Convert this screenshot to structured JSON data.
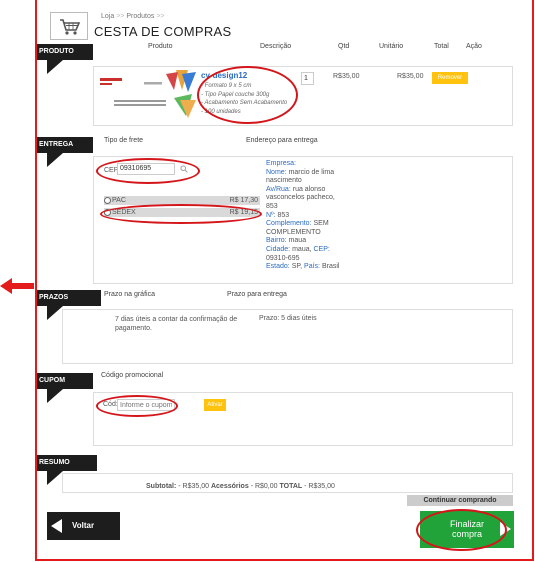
{
  "breadcrumb": {
    "home": "Loja",
    "sep": ">>",
    "products": "Produtos"
  },
  "page_title": "CESTA DE COMPRAS",
  "product_section": {
    "tab": "PRODUTO",
    "headers": [
      "Produto",
      "Descrição",
      "Qtd",
      "Unitário",
      "Total",
      "Ação"
    ],
    "item": {
      "name": "cv-design12",
      "specs": [
        "- Formato 9 x 5 cm",
        "- Tipo Papel couche 300g",
        "- Acabamento Sem Acabamento",
        "- 100 unidades"
      ],
      "quantity": "1",
      "unit_price": "R$35,00",
      "total": "R$35,00",
      "remove_label": "Remover"
    }
  },
  "delivery_section": {
    "tab": "ENTREGA",
    "freight_header": "Tipo de frete",
    "address_header": "Endereço para entrega",
    "cep_label": "CEP:",
    "cep_value": "09310695",
    "options": [
      {
        "name": "PAC",
        "price": "R$ 17,30"
      },
      {
        "name": "SEDEX",
        "price": "R$ 19,15"
      }
    ],
    "address": [
      {
        "label": "Empresa:",
        "value": ""
      },
      {
        "label": "Nome:",
        "value": "marcio de lima nascimento"
      },
      {
        "label": "Av/Rua:",
        "value": "rua alonso vasconcelos pacheco, 853"
      },
      {
        "label": "Nº:",
        "value": "853"
      },
      {
        "label": "Complemento:",
        "value": "SEM COMPLEMENTO"
      },
      {
        "label": "Bairro:",
        "value": "maua"
      },
      {
        "label": "Cidade:",
        "value": "maua"
      },
      {
        "label": "CEP:",
        "value": "09310-695"
      },
      {
        "label": "Estado:",
        "value": "SP"
      },
      {
        "label": "País:",
        "value": "Brasil"
      }
    ]
  },
  "deadline_section": {
    "tab": "PRAZOS",
    "print_header": "Prazo na gráfica",
    "delivery_header": "Prazo para entrega",
    "print_text": "7 dias úteis a contar da confirmação de pagamento.",
    "delivery_text": "Prazo: 5 dias úteis"
  },
  "coupon_section": {
    "tab": "CUPOM",
    "header": "Código promocional",
    "code_label": "Cód:",
    "placeholder": "Informe o cupom",
    "apply_label": "Ativar"
  },
  "summary_section": {
    "tab": "RESUMO",
    "subtotal_label": "Subtotal:",
    "subtotal_value": "- R$35,00",
    "accessories_label": "Acessórios",
    "accessories_value": "- R$0,00",
    "total_label": "TOTAL",
    "total_value": "- R$35,00"
  },
  "actions": {
    "continue_label": "Continuar comprando",
    "back_label": "Voltar",
    "checkout_line1": "Finalizar",
    "checkout_line2": "compra"
  },
  "colors": {
    "highlight_red": "#d4161b",
    "accent_yellow": "#ffc20e",
    "checkout_green": "#22a33a",
    "tab_black": "#1d1d1d",
    "link_blue": "#2a6cc0"
  }
}
